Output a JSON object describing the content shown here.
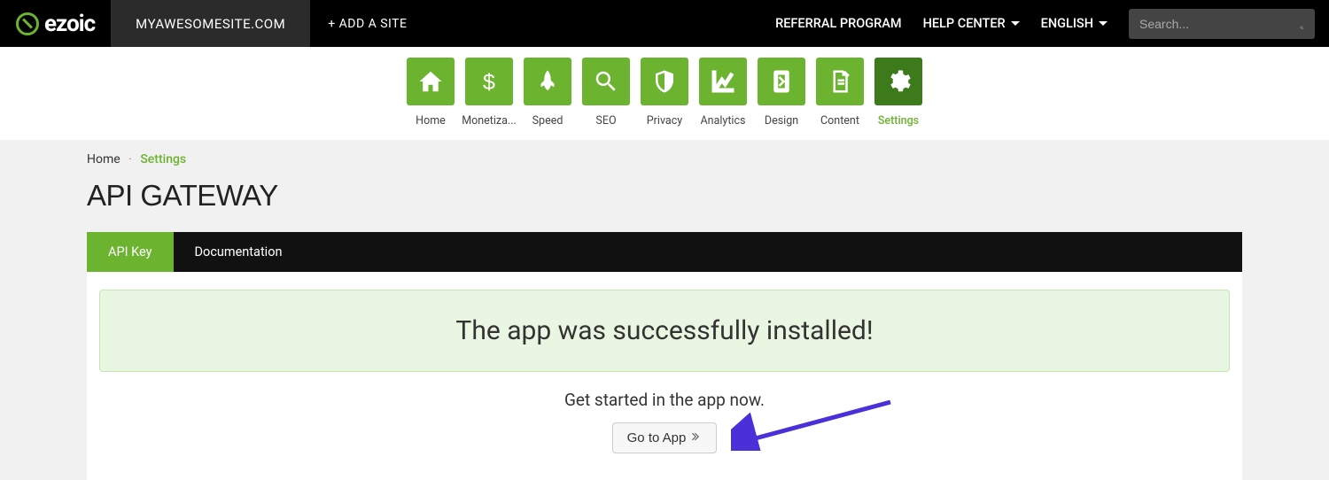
{
  "topbar": {
    "brand": "ezoic",
    "site_tab": "MYAWESOMESITE.COM",
    "add_site": "+ ADD A SITE",
    "links": {
      "referral": "REFERRAL PROGRAM",
      "help": "HELP CENTER",
      "language": "ENGLISH"
    },
    "search_placeholder": "Search..."
  },
  "nav": {
    "home": "Home",
    "monetization": "Monetiza...",
    "speed": "Speed",
    "seo": "SEO",
    "privacy": "Privacy",
    "analytics": "Analytics",
    "design": "Design",
    "content": "Content",
    "settings": "Settings"
  },
  "breadcrumb": {
    "home": "Home",
    "current": "Settings"
  },
  "page": {
    "title": "API GATEWAY",
    "tabs": {
      "api_key": "API Key",
      "documentation": "Documentation"
    },
    "alert": "The app was successfully installed!",
    "subtext": "Get started in the app now.",
    "cta": "Go to App"
  }
}
